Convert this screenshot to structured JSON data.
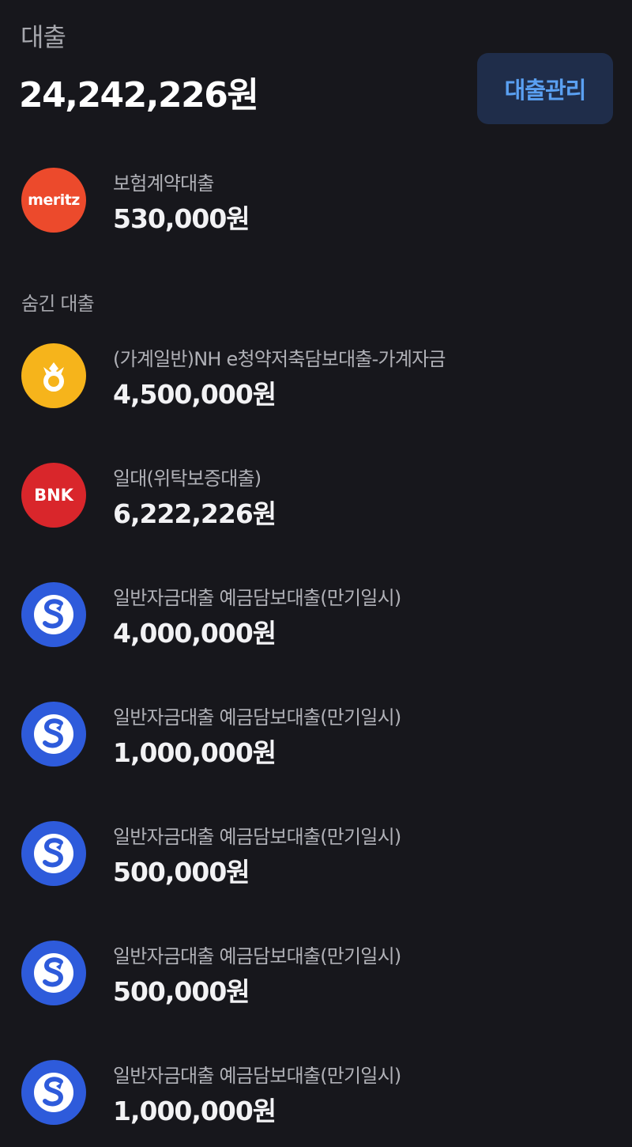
{
  "header": {
    "title": "대출",
    "total": "24,242,226원",
    "manage_label": "대출관리"
  },
  "visible_loans": [
    {
      "name": "보험계약대출",
      "amount": "530,000원",
      "logo": "meritz-logo",
      "logo_text": "meritz",
      "logo_color": "#ec4a2c"
    }
  ],
  "hidden_section_label": "숨긴 대출",
  "hidden_loans": [
    {
      "name": "(가계일반)NH e청약저축담보대출-가계자금",
      "amount": "4,500,000원",
      "logo": "nh-logo",
      "logo_color": "#f6b41b"
    },
    {
      "name": "일대(위탁보증대출)",
      "amount": "6,222,226원",
      "logo": "bnk-logo",
      "logo_text": "BNK",
      "logo_color": "#d9262b"
    },
    {
      "name": "일반자금대출 예금담보대출(만기일시)",
      "amount": "4,000,000원",
      "logo": "shinhan-logo",
      "logo_color": "#2e5bdb"
    },
    {
      "name": "일반자금대출 예금담보대출(만기일시)",
      "amount": "1,000,000원",
      "logo": "shinhan-logo",
      "logo_color": "#2e5bdb"
    },
    {
      "name": "일반자금대출 예금담보대출(만기일시)",
      "amount": "500,000원",
      "logo": "shinhan-logo",
      "logo_color": "#2e5bdb"
    },
    {
      "name": "일반자금대출 예금담보대출(만기일시)",
      "amount": "500,000원",
      "logo": "shinhan-logo",
      "logo_color": "#2e5bdb"
    },
    {
      "name": "일반자금대출 예금담보대출(만기일시)",
      "amount": "1,000,000원",
      "logo": "shinhan-logo",
      "logo_color": "#2e5bdb"
    }
  ]
}
